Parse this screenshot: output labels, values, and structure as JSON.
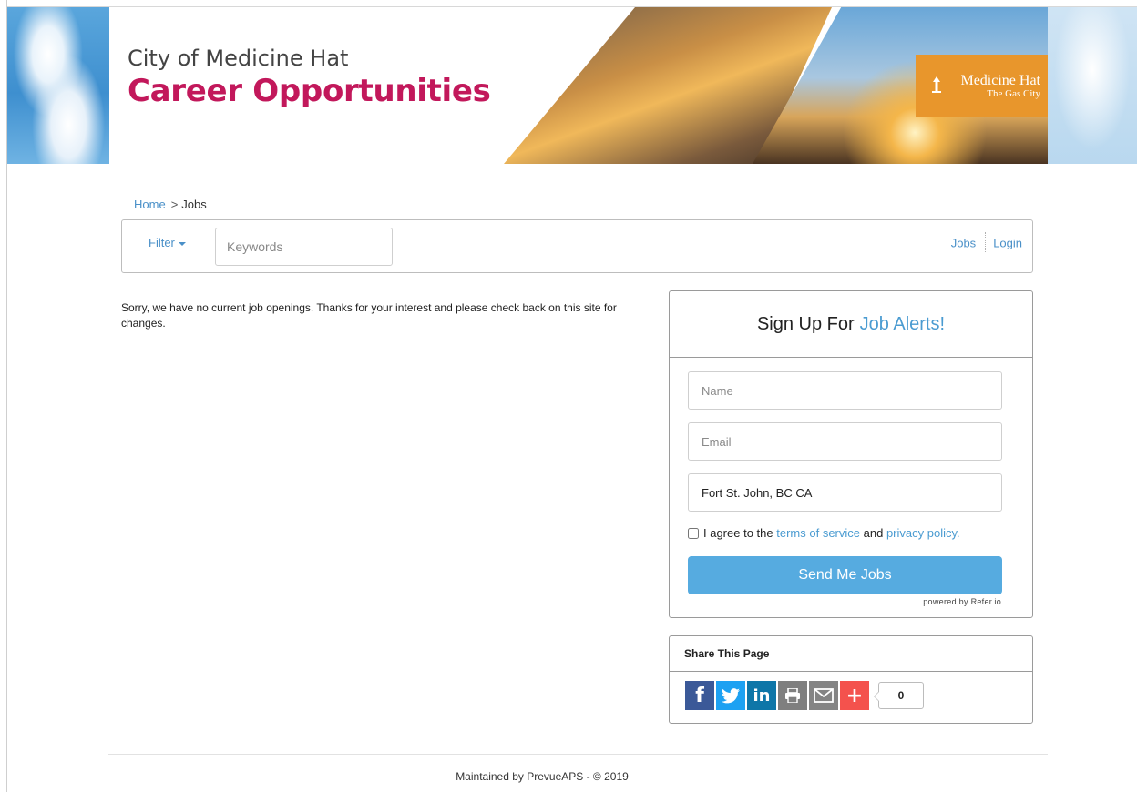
{
  "header": {
    "title_small": "City of Medicine Hat",
    "title_big": "Career Opportunities",
    "logo_main": "Medicine Hat",
    "logo_sub": "The Gas City"
  },
  "breadcrumb": {
    "home": "Home",
    "separator": ">",
    "current": "Jobs"
  },
  "filterbar": {
    "filter_label": "Filter",
    "keywords_placeholder": "Keywords",
    "nav_jobs": "Jobs",
    "nav_login": "Login"
  },
  "main": {
    "no_jobs_message": "Sorry, we have no current job openings. Thanks for your interest and please check back on this site for changes."
  },
  "signup": {
    "heading_prefix": "Sign Up For",
    "heading_accent": "Job Alerts!",
    "name_placeholder": "Name",
    "email_placeholder": "Email",
    "location_value": "Fort St. John, BC CA",
    "agree_prefix": "I agree to the",
    "terms_link": "terms of service",
    "agree_and": "and",
    "privacy_link": "privacy policy.",
    "submit_label": "Send Me Jobs",
    "powered_by": "powered by Refer.io"
  },
  "share": {
    "heading": "Share This Page",
    "icons": [
      "facebook-icon",
      "twitter-icon",
      "linkedin-icon",
      "print-icon",
      "email-icon",
      "plus-icon"
    ],
    "count": "0"
  },
  "footer": {
    "text": "Maintained by PrevueAPS - © 2019"
  },
  "colors": {
    "brand_magenta": "#c2185b",
    "link_blue": "#4a90c8",
    "button_blue": "#56abe0",
    "logo_orange": "#e8962c"
  }
}
